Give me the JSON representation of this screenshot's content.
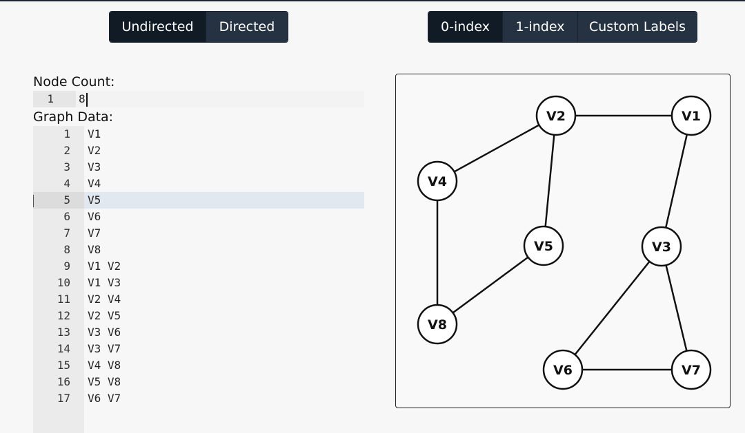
{
  "direction_toggle": {
    "options": [
      {
        "label": "Undirected",
        "active": true
      },
      {
        "label": "Directed",
        "active": false
      }
    ]
  },
  "index_toggle": {
    "options": [
      {
        "label": "0-index",
        "active": true
      },
      {
        "label": "1-index",
        "active": false
      },
      {
        "label": "Custom Labels",
        "active": false
      }
    ]
  },
  "node_count": {
    "label": "Node Count:",
    "line_number": "1",
    "value": "8"
  },
  "graph_data": {
    "label": "Graph Data:",
    "lines": [
      "V1",
      "V2",
      "V3",
      "V4",
      "V5",
      "V6",
      "V7",
      "V8",
      "V1 V2",
      "V1 V3",
      "V2 V4",
      "V2 V5",
      "V3 V6",
      "V3 V7",
      "V4 V8",
      "V5 V8",
      "V6 V7"
    ],
    "active_line": 5
  },
  "graph": {
    "nodes": [
      "V1",
      "V2",
      "V3",
      "V4",
      "V5",
      "V6",
      "V7",
      "V8"
    ],
    "edges": [
      [
        "V1",
        "V2"
      ],
      [
        "V1",
        "V3"
      ],
      [
        "V2",
        "V4"
      ],
      [
        "V2",
        "V5"
      ],
      [
        "V3",
        "V6"
      ],
      [
        "V3",
        "V7"
      ],
      [
        "V4",
        "V8"
      ],
      [
        "V5",
        "V8"
      ],
      [
        "V6",
        "V7"
      ]
    ]
  },
  "colors": {
    "button_bg": "#253242",
    "button_active_bg": "#111b26",
    "highlight_line": "#e2e8f0"
  }
}
